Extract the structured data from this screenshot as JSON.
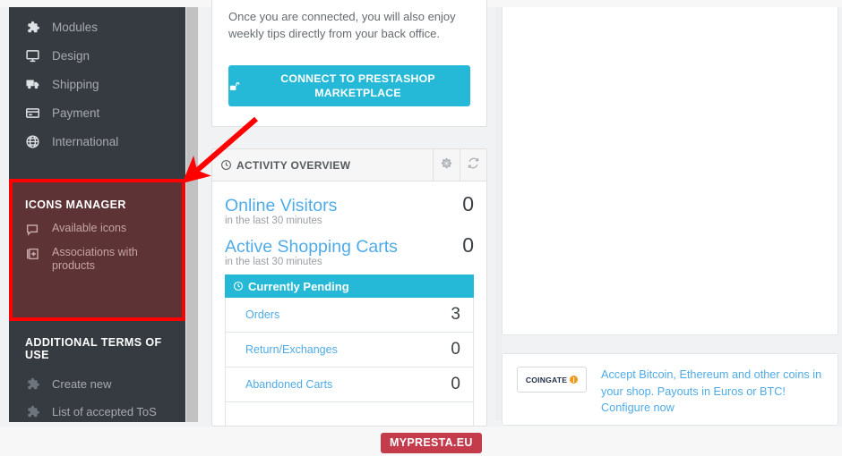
{
  "sidebar": {
    "nav_items": [
      {
        "label": "Modules",
        "icon": "puzzle-icon"
      },
      {
        "label": "Design",
        "icon": "monitor-icon"
      },
      {
        "label": "Shipping",
        "icon": "truck-icon"
      },
      {
        "label": "Payment",
        "icon": "credit-card-icon"
      },
      {
        "label": "International",
        "icon": "globe-icon"
      }
    ],
    "icons_manager": {
      "title": "ICONS MANAGER",
      "highlight_color": "#ff0000",
      "background_color": "#5d3335",
      "items": [
        {
          "label": "Available icons",
          "icon": "comment-icon"
        },
        {
          "label": "Associations with products",
          "icon": "add-box-icon"
        }
      ]
    },
    "additional_terms": {
      "title": "ADDITIONAL TERMS OF USE",
      "items": [
        {
          "label": "Create new",
          "icon": "puzzle-icon"
        },
        {
          "label": "List of accepted ToS",
          "icon": "puzzle-icon"
        }
      ]
    }
  },
  "marketplace": {
    "text": "Once you are connected, you will also enjoy weekly tips directly from your back office.",
    "button_label": "CONNECT TO PRESTASHOP MARKETPLACE",
    "button_icon": "unlock-icon",
    "button_color": "#25b9d7"
  },
  "activity_overview": {
    "title": "ACTIVITY OVERVIEW",
    "title_icon": "clock-icon",
    "tools": [
      {
        "icon": "gear-icon",
        "name": "settings"
      },
      {
        "icon": "refresh-icon",
        "name": "refresh"
      }
    ],
    "stats": [
      {
        "label": "Online Visitors",
        "value": "0",
        "sub": "in the last 30 minutes"
      },
      {
        "label": "Active Shopping Carts",
        "value": "0",
        "sub": "in the last 30 minutes"
      }
    ],
    "pending": {
      "header": "Currently Pending",
      "header_icon": "clock-icon",
      "rows": [
        {
          "label": "Orders",
          "value": "3"
        },
        {
          "label": "Return/Exchanges",
          "value": "0"
        },
        {
          "label": "Abandoned Carts",
          "value": "0"
        }
      ]
    }
  },
  "coingate": {
    "logo_text": "COINGATE",
    "message": "Accept Bitcoin, Ethereum and other coins in your shop. Payouts in Euros or BTC! Configure now"
  },
  "annotation": {
    "arrow_color": "#ff0000"
  },
  "footer": {
    "badge": "MYPRESTA.EU",
    "badge_color": "#c43b4b"
  }
}
